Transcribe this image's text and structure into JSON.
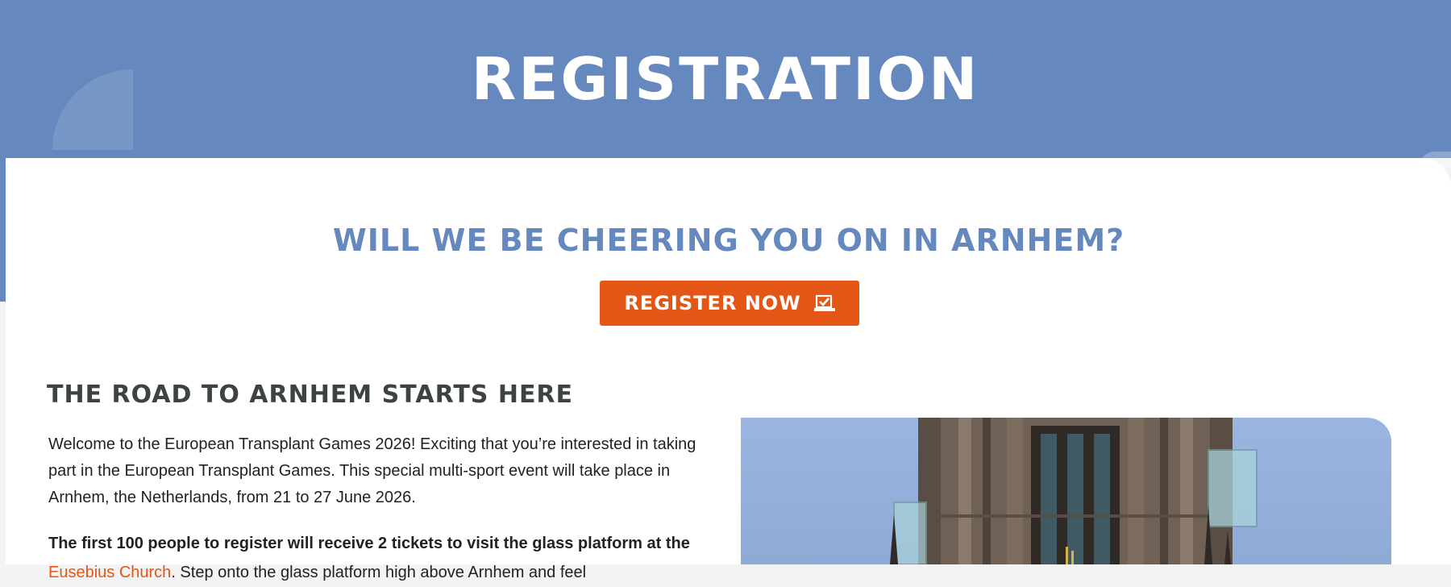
{
  "hero": {
    "title": "REGISTRATION"
  },
  "main": {
    "cheer_heading": "WILL WE BE CHEERING YOU ON IN ARNHEM?",
    "register_button": {
      "label": "REGISTER NOW",
      "icon": "check-in-icon"
    },
    "section_heading": "THE ROAD TO ARNHEM STARTS HERE",
    "intro_text": "Welcome to the European Transplant Games 2026! Exciting that you’re interested in taking part in the European Transplant Games. This special multi-sport event will take place in Arnhem, the Netherlands, from 21 to 27 June 2026.",
    "bold_text": "The first 100 people to register will receive 2 tickets to visit the glass platform",
    "bold_text_cont": "at the",
    "link_text": "Eusebius Church",
    "rest_text": ". Step onto the glass platform high above Arnhem and feel",
    "photo": {
      "subject": "eusebius-church-tower-photo"
    }
  },
  "colors": {
    "brand_blue": "#6589bf",
    "accent_orange": "#e45615",
    "heading_dark": "#3c4341",
    "background": "#ffffff"
  }
}
